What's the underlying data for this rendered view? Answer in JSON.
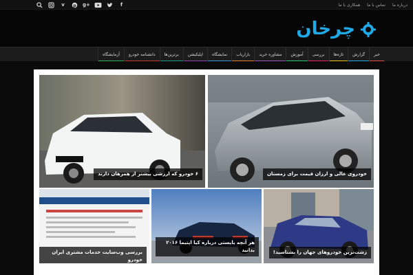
{
  "topbar": {
    "links": [
      "دربارە ما",
      "تماس با ما",
      "همکاری با ما"
    ],
    "social_icons": [
      "facebook-icon",
      "twitter-icon",
      "youtube-icon",
      "googleplus-icon",
      "pinterest-icon",
      "vimeo-icon",
      "instagram-icon",
      "search-icon"
    ]
  },
  "logo": {
    "text": "چرخان"
  },
  "nav": {
    "items": [
      {
        "label": "خبر",
        "color": "#e74c3c"
      },
      {
        "label": "گزارش",
        "color": "#1fa9e6"
      },
      {
        "label": "تازه‌ها",
        "color": "#f1c40f"
      },
      {
        "label": "بررسی",
        "color": "#e91e63"
      },
      {
        "label": "آموزش",
        "color": "#2ecc71"
      },
      {
        "label": "مشاوره خرید",
        "color": "#9b59b6"
      },
      {
        "label": "بازاریاب",
        "color": "#e67e22"
      },
      {
        "label": "نمایشگاه",
        "color": "#3498db"
      },
      {
        "label": "اپلیکیشن",
        "color": "#8e44ad"
      },
      {
        "label": "برترین‌ها",
        "color": "#16a085"
      },
      {
        "label": "دانشنامه خودرو",
        "color": "#c0392b"
      },
      {
        "label": "آزمایشگاه",
        "color": "#27ae60"
      }
    ]
  },
  "tiles": [
    {
      "caption": "خودروی عالی و ارزان قیمت برای زمستان"
    },
    {
      "caption": "۶ خودرو که ارزشی بیشتر از همرهان دارند"
    },
    {
      "caption": "زشت‌ترین خودروهای جهان را بشناسید!"
    },
    {
      "caption": "هر آنچه بایستی درباره کیا اپتیما ۲۰۱۶ بدانید"
    },
    {
      "caption": "بررسی وب‌سایت خدمات مشتری ایران خودرو"
    }
  ]
}
